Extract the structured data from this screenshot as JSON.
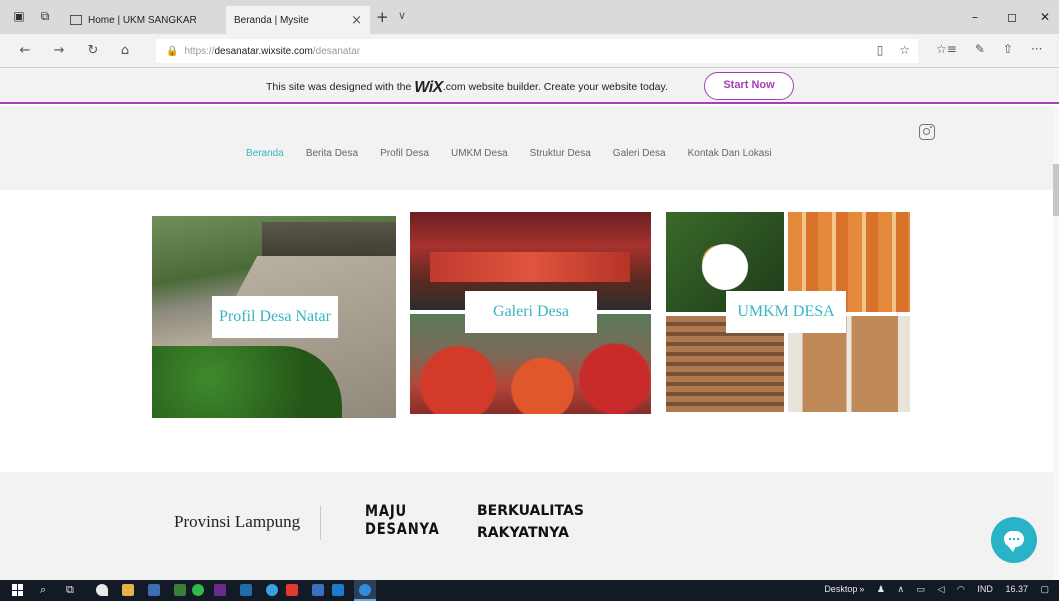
{
  "browser": {
    "tabs": [
      {
        "label": "Home | UKM SANGKAR BUI",
        "active": false
      },
      {
        "label": "Beranda | Mysite",
        "active": true
      }
    ],
    "tab_close": "×",
    "new_tab": "+",
    "tab_list": "∨",
    "window_controls": {
      "minimize": "–",
      "maximize": "◻",
      "close": "✕"
    },
    "nav": {
      "back": "←",
      "forward": "→",
      "refresh": "↻",
      "home": "⌂"
    },
    "url": {
      "lock": "🔒",
      "prefix": "https://",
      "domain": "desanatar.wixsite.com",
      "path": "/desanatar"
    },
    "url_icons": {
      "reading": "▯",
      "favorite": "☆"
    },
    "tools": {
      "favorites": "☆≡",
      "notes": "✎",
      "share": "⇧",
      "more": "···"
    }
  },
  "wix_banner": {
    "text_before": "This site was designed with the ",
    "logo": "WiX",
    "text_after": ".com website builder. Create your website today.",
    "button": "Start Now"
  },
  "site": {
    "nav": [
      {
        "label": "Beranda",
        "active": true
      },
      {
        "label": "Berita Desa",
        "active": false
      },
      {
        "label": "Profil Desa",
        "active": false
      },
      {
        "label": "UMKM Desa",
        "active": false
      },
      {
        "label": "Struktur Desa",
        "active": false
      },
      {
        "label": "Galeri Desa",
        "active": false
      },
      {
        "label": "Kontak Dan Lokasi",
        "active": false
      }
    ],
    "social": "instagram-icon",
    "cards": [
      {
        "caption": "Profil Desa Natar"
      },
      {
        "caption": "Galeri Desa"
      },
      {
        "caption": "UMKM DESA"
      }
    ],
    "footer": {
      "province": "Provinsi Lampung",
      "slogan1_line1": "MAJU",
      "slogan1_line2": "DESANYA",
      "slogan2_line1": "BERKUALITAS",
      "slogan2_line2": "RAKYATNYA"
    }
  },
  "taskbar": {
    "desktop": "Desktop",
    "chevron": "»",
    "lang": "IND",
    "time": "16.37"
  },
  "colors": {
    "accent": "#37b5c4",
    "wix_purple": "#a540b6",
    "chat": "#2ab3c6"
  }
}
